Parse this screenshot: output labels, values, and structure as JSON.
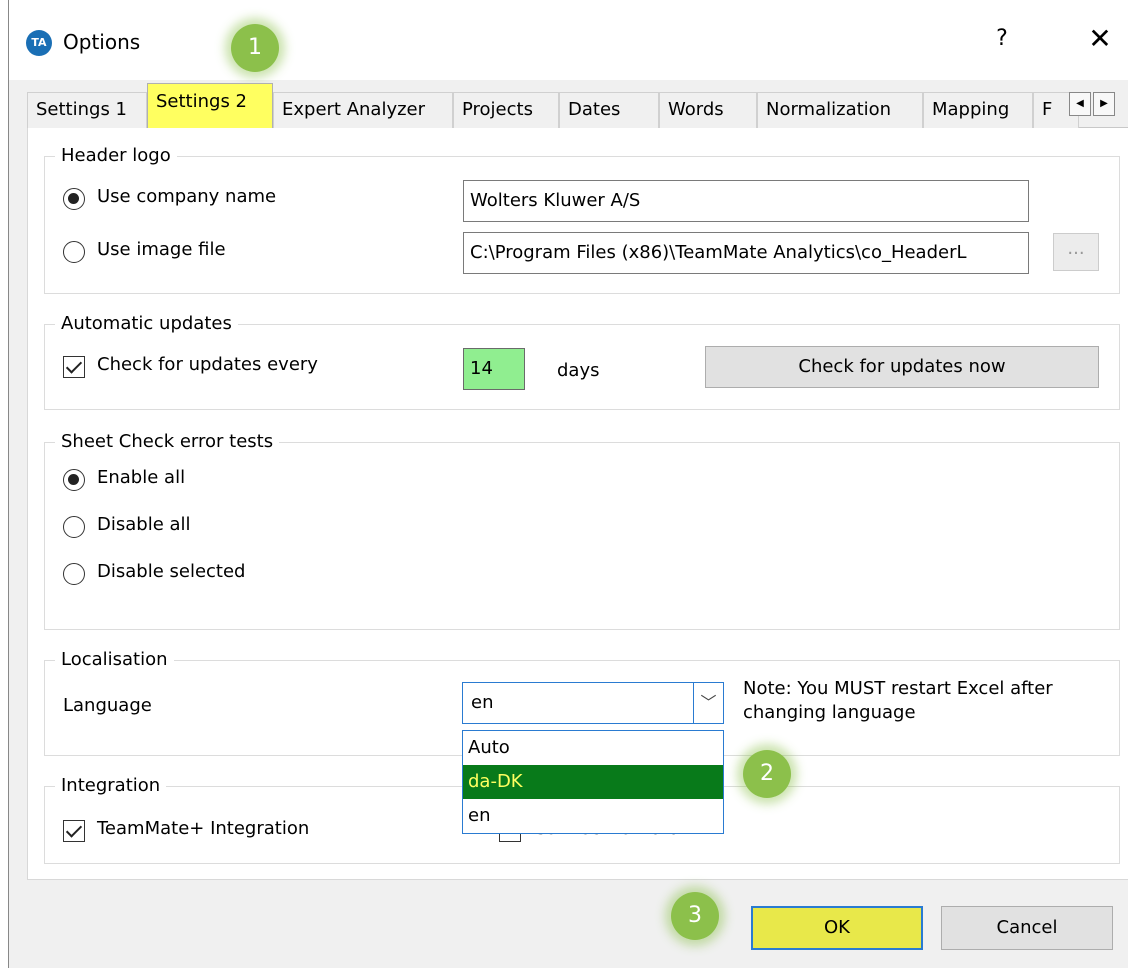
{
  "window": {
    "app_icon": "TA",
    "title": "Options",
    "help": "?",
    "close": "✕"
  },
  "callouts": [
    "1",
    "2",
    "3"
  ],
  "tabs": [
    {
      "label": "Settings 1"
    },
    {
      "label": "Settings 2",
      "active": true
    },
    {
      "label": "Expert Analyzer"
    },
    {
      "label": "Projects"
    },
    {
      "label": "Dates"
    },
    {
      "label": "Words"
    },
    {
      "label": "Normalization"
    },
    {
      "label": "Mapping"
    },
    {
      "label": "F"
    }
  ],
  "tab_scroll": {
    "left": "◀",
    "right": "▶"
  },
  "header_logo": {
    "title": "Header logo",
    "use_company_name": {
      "label": "Use company name",
      "selected": true
    },
    "company_name_value": "Wolters Kluwer A/S",
    "use_image_file": {
      "label": "Use image file",
      "selected": false
    },
    "image_file_value": "C:\\Program Files (x86)\\TeamMate Analytics\\co_HeaderL",
    "browse_label": "..."
  },
  "automatic_updates": {
    "title": "Automatic updates",
    "check_label": "Check for updates every",
    "checked": true,
    "days_value": "14",
    "days_label": "days",
    "check_now_label": "Check for updates now"
  },
  "sheet_check": {
    "title": "Sheet Check error tests",
    "options": [
      {
        "label": "Enable all",
        "selected": true
      },
      {
        "label": "Disable all",
        "selected": false
      },
      {
        "label": "Disable selected",
        "selected": false
      }
    ]
  },
  "localisation": {
    "title": "Localisation",
    "language_label": "Language",
    "language_value": "en",
    "note": "Note: You MUST restart Excel after changing language",
    "options": [
      "Auto",
      "da-DK",
      "en"
    ],
    "highlighted_option": "da-DK"
  },
  "integration": {
    "title": "Integration",
    "teammate_label": "TeamMate+ Integration",
    "teammate_checked": true,
    "connect_label": "Connect to Data"
  },
  "footer": {
    "ok_label": "OK",
    "cancel_label": "Cancel"
  },
  "colors": {
    "highlight_yellow": "#ffff60",
    "selected_green": "#087a1a",
    "callout_green": "#8cc04b",
    "days_field_green": "#90ee90"
  }
}
